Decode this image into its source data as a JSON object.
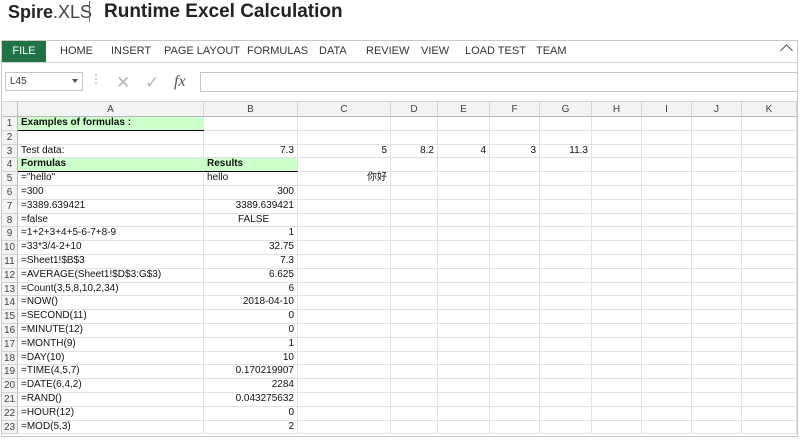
{
  "brand": {
    "logo_bold": "Spire",
    "logo_rest": ".XLS",
    "title": "Runtime Excel Calculation"
  },
  "ribbon": {
    "file_tab": "FILE",
    "tabs": [
      "HOME",
      "INSERT",
      "PAGE LAYOUT",
      "FORMULAS",
      "DATA",
      "REVIEW",
      "VIEW",
      "LOAD TEST",
      "TEAM"
    ],
    "accent_color": "#217346"
  },
  "formula_bar": {
    "name_box": "L45",
    "separator": "⋮",
    "cancel_icon": "✕",
    "enter_icon": "✓",
    "fx_label": "fx",
    "formula": ""
  },
  "sheet": {
    "columns": [
      "A",
      "B",
      "C",
      "D",
      "E",
      "F",
      "G",
      "H",
      "I",
      "J",
      "K"
    ],
    "rows": [
      "1",
      "2",
      "3",
      "4",
      "5",
      "6",
      "7",
      "8",
      "9",
      "10",
      "11",
      "12",
      "13",
      "14",
      "15",
      "16",
      "17",
      "18",
      "19",
      "20",
      "21",
      "22",
      "23"
    ],
    "cells": {
      "A1": "Examples of formulas :",
      "A3": "Test data:",
      "B3": "7.3",
      "C3": "5",
      "D3": "8.2",
      "E3": "4",
      "F3": "3",
      "G3": "11.3",
      "A4": "Formulas",
      "B4": "Results",
      "A5": "=\"hello\"",
      "B5": "hello",
      "C5": "你好",
      "A6": "=300",
      "B6": "300",
      "A7": "=3389.639421",
      "B7": "3389.639421",
      "A8": "=false",
      "B8": "FALSE",
      "A9": "=1+2+3+4+5-6-7+8-9",
      "B9": "1",
      "A10": "=33*3/4-2+10",
      "B10": "32.75",
      "A11": "=Sheet1!$B$3",
      "B11": "7.3",
      "A12": "=AVERAGE(Sheet1!$D$3:G$3)",
      "B12": "6.625",
      "A13": "=Count(3,5,8,10,2,34)",
      "B13": "6",
      "A14": "=NOW()",
      "B14": "2018-04-10",
      "A15": "=SECOND(11)",
      "B15": "0",
      "A16": "=MINUTE(12)",
      "B16": "0",
      "A17": "=MONTH(9)",
      "B17": "1",
      "A18": "=DAY(10)",
      "B18": "10",
      "A19": "=TIME(4,5,7)",
      "B19": "0.170219907",
      "A20": "=DATE(6,4,2)",
      "B20": "2284",
      "A21": "=RAND()",
      "B21": "0.043275632",
      "A22": "=HOUR(12)",
      "B22": "0",
      "A23": "=MOD(5,3)",
      "B23": "2"
    },
    "header_fill_color": "#ccffcc"
  }
}
